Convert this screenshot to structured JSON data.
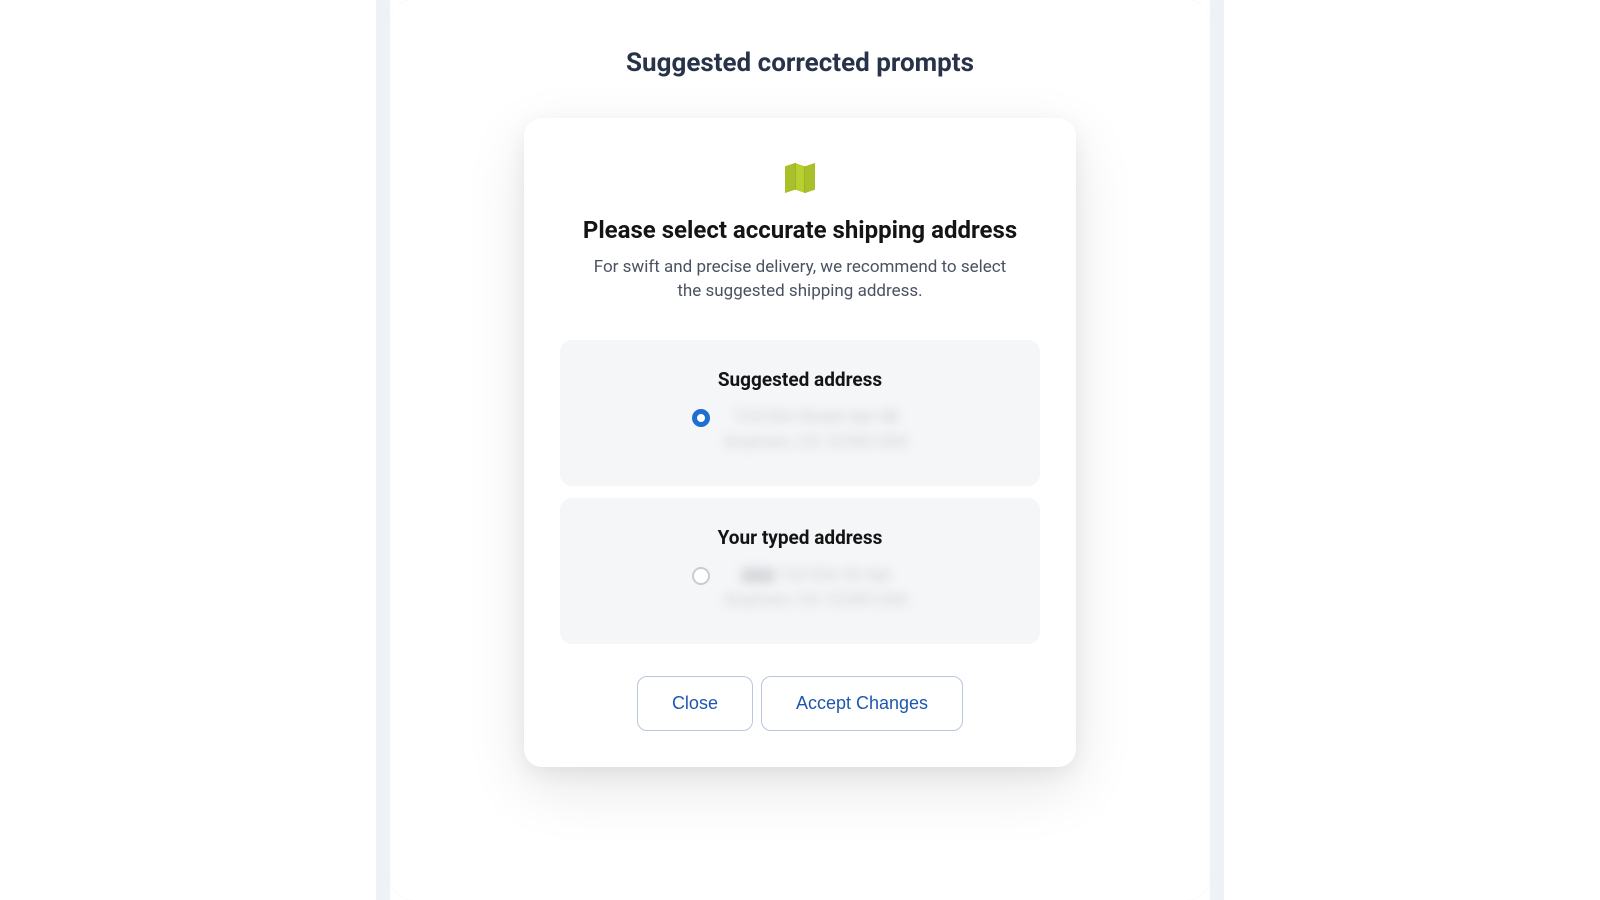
{
  "page": {
    "title": "Suggested corrected prompts"
  },
  "modal": {
    "heading": "Please select accurate shipping address",
    "subtext": "For swift and precise delivery, we recommend to select the suggested shipping address.",
    "options": {
      "suggested": {
        "title": "Suggested address",
        "address_line1": "123 Elm Street Apt 4B",
        "address_line2": "Anytown, CA 12345 USA",
        "selected": true
      },
      "typed": {
        "title": "Your typed address",
        "address_line1": "123 Elm St Apt",
        "address_line2": "Anytown, CA 12345 USA",
        "selected": false
      }
    },
    "buttons": {
      "close": "Close",
      "accept": "Accept Changes"
    }
  },
  "icons": {
    "map": "map-icon"
  },
  "colors": {
    "accent": "#1f6fd1",
    "icon": "#b7cf2f",
    "heading": "#283349"
  }
}
